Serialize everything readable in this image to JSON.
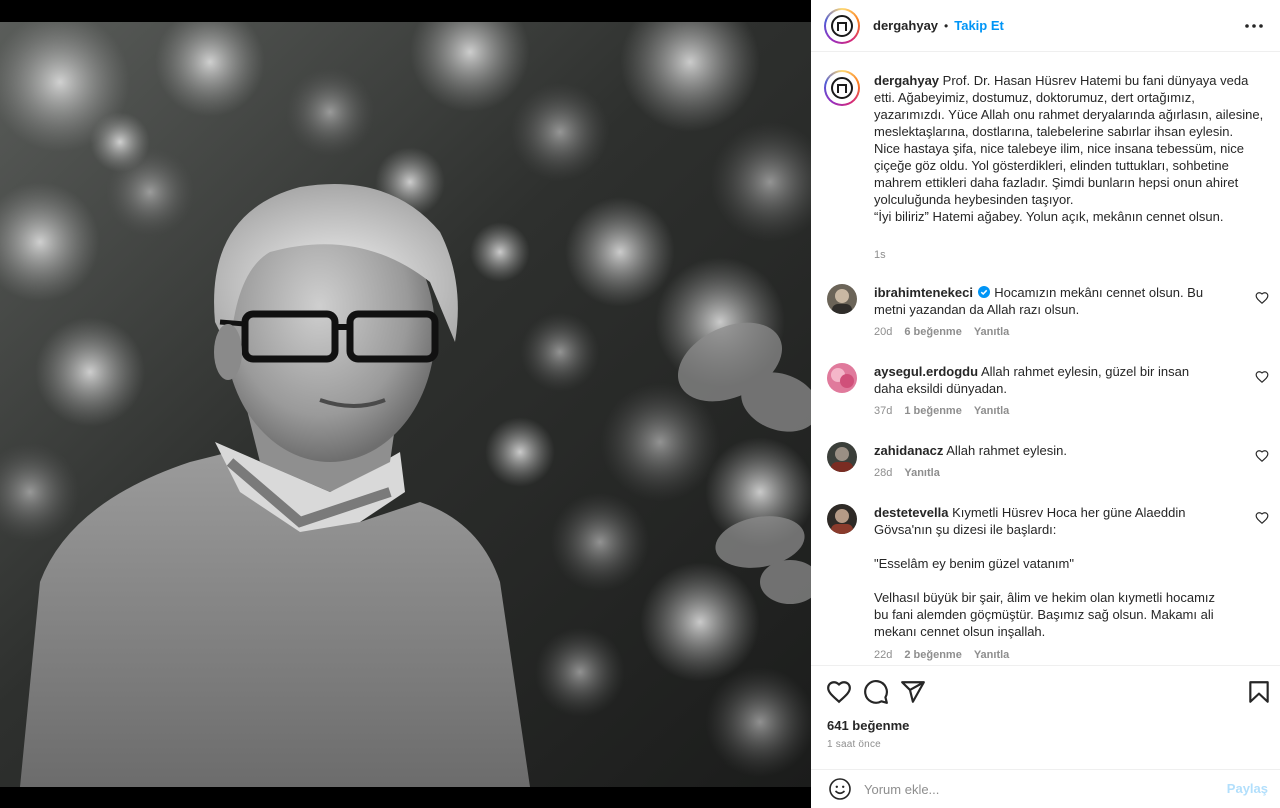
{
  "post": {
    "username": "dergahyay",
    "separator": "•",
    "follow_label": "Takip Et",
    "more_icon": "more-horizontal-icon",
    "image_alt": "Black and white portrait of an elderly man with glasses in a sweater, foliage background"
  },
  "caption": {
    "username": "dergahyay",
    "text": "Prof. Dr. Hasan Hüsrev Hatemi bu fani dünyaya veda etti. Ağabeyimiz, dostumuz, doktorumuz, dert ortağımız, yazarımızdı. Yüce Allah onu rahmet deryalarında ağırlasın, ailesine, meslektaşlarına, dostlarına, talebelerine sabırlar ihsan eylesin.\nNice hastaya şifa, nice talebeye ilim, nice insana tebessüm, nice çiçeğe göz oldu. Yol gösterdikleri, elinden tuttukları, sohbetine mahrem ettikleri daha fazladır. Şimdi bunların hepsi onun ahiret yolculuğunda heybesinden taşıyor.\n“İyi biliriz” Hatemi ağabey. Yolun açık, mekânın cennet olsun.",
    "time": "1s"
  },
  "comments": [
    {
      "username": "ibrahimtenekeci",
      "verified": true,
      "text": "Hocamızın mekânı cennet olsun. Bu metni yazandan da Allah razı olsun.",
      "time": "20d",
      "likes": "6 beğenme",
      "reply": "Yanıtla"
    },
    {
      "username": "aysegul.erdogdu",
      "verified": false,
      "text": "Allah rahmet eylesin, güzel bir insan daha eksildi dünyadan.",
      "time": "37d",
      "likes": "1 beğenme",
      "reply": "Yanıtla"
    },
    {
      "username": "zahidanacz",
      "verified": false,
      "text": "Allah rahmet eylesin.",
      "time": "28d",
      "likes": "",
      "reply": "Yanıtla"
    },
    {
      "username": "destetevella",
      "verified": false,
      "text": "Kıymetli Hüsrev Hoca her güne Alaeddin Gövsa'nın şu dizesi ile başlardı:\n\n\"Esselâm ey benim güzel vatanım\"\n\nVelhasıl büyük bir şair, âlim ve hekim olan kıymetli hocamız bu fani alemden göçmüştür. Başımız sağ olsun. Makamı ali mekanı cennet olsun inşallah.",
      "time": "22d",
      "likes": "2 beğenme",
      "reply": "Yanıtla"
    }
  ],
  "actions": {
    "like_icon": "heart-icon",
    "comment_icon": "comment-icon",
    "share_icon": "send-icon",
    "save_icon": "bookmark-icon",
    "likes_count": "641 beğenme",
    "posted_ago": "1 saat önce"
  },
  "comment_box": {
    "emoji_icon": "smiley-icon",
    "placeholder": "Yorum ekle...",
    "submit_label": "Paylaş"
  },
  "colors": {
    "link_blue": "#0095f6",
    "disabled_blue": "#b2dffc",
    "muted_text": "#8e8e8e",
    "divider": "#efefef"
  }
}
